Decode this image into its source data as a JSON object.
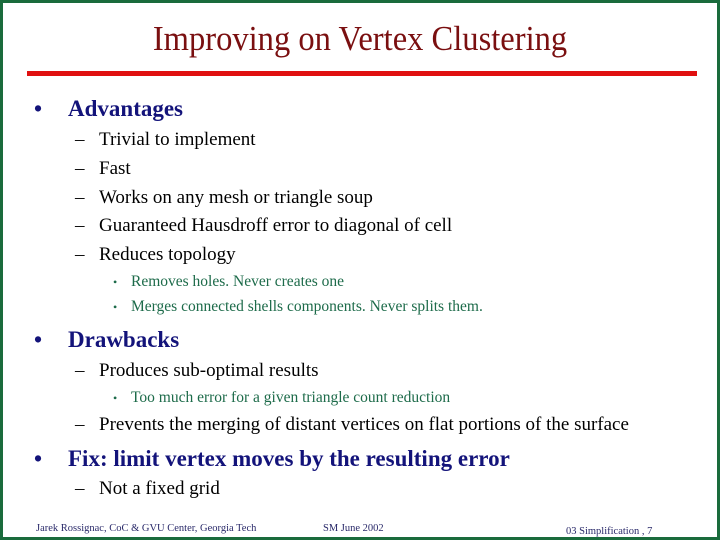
{
  "slide": {
    "title": "Improving on Vertex Clustering",
    "bullet_glyph": "•",
    "dash_glyph": "–",
    "sub_bullet_glyph": "•",
    "sections": [
      {
        "heading": "Advantages",
        "items": [
          {
            "text": "Trivial to implement"
          },
          {
            "text": "Fast"
          },
          {
            "text": "Works on any mesh or triangle soup"
          },
          {
            "text": "Guaranteed Hausdroff error to diagonal of cell"
          },
          {
            "text": "Reduces topology",
            "sub": [
              "Removes holes. Never creates one",
              "Merges connected shells components. Never splits them."
            ]
          }
        ]
      },
      {
        "heading": "Drawbacks",
        "items": [
          {
            "text": "Produces sub-optimal results",
            "sub": [
              "Too much error for a given triangle count reduction"
            ]
          },
          {
            "text": "Prevents the merging of distant vertices on flat portions of the surface"
          }
        ]
      },
      {
        "heading": "Fix: limit vertex moves by the resulting error",
        "items": [
          {
            "text": "Not a fixed grid"
          }
        ]
      }
    ]
  },
  "footer": {
    "author": "Jarek Rossignac, CoC & GVU Center, Georgia Tech",
    "event": "SM June 2002",
    "page": "03 Simplification , 7"
  },
  "colors": {
    "border": "#1a6b3c",
    "title": "#7a0f10",
    "rule": "#e01010",
    "heading": "#13137a",
    "body": "#000000",
    "sub": "#1d6b4a"
  }
}
